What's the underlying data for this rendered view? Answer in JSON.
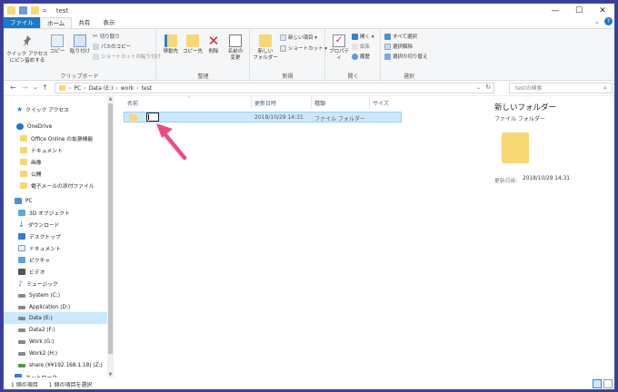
{
  "window": {
    "title": "test",
    "minimize": "—",
    "maximize": "☐",
    "close": "✕"
  },
  "tabs": [
    "ファイル",
    "ホーム",
    "共有",
    "表示"
  ],
  "ribbon": {
    "clipboard": {
      "pin_quick_line1": "クイック アクセス",
      "pin_quick_line2": "にピン留めする",
      "copy": "コピー",
      "paste": "貼り付け",
      "cut": "切り取り",
      "copy_path": "パスのコピー",
      "paste_shortcut": "ショートカットの貼り付け",
      "label": "クリップボード"
    },
    "organize": {
      "move_to": "移動先",
      "copy_to": "コピー先",
      "delete": "削除",
      "rename_line1": "名前の",
      "rename_line2": "変更",
      "label": "整理"
    },
    "new": {
      "new_folder_line1": "新しい",
      "new_folder_line2": "フォルダー",
      "new_item": "新しい項目 ▾",
      "shortcut": "ショートカット ▾",
      "label": "新規"
    },
    "open": {
      "properties": "プロパティ",
      "open": "開く ▾",
      "edit": "編集",
      "history": "履歴",
      "label": "開く"
    },
    "select": {
      "select_all": "すべて選択",
      "select_none": "選択解除",
      "invert": "選択の切り替え",
      "label": "選択"
    }
  },
  "address": {
    "back": "←",
    "forward": "→",
    "up_dropdown": "⌄",
    "up": "↑",
    "crumbs": [
      "PC",
      "Data (E:)",
      "work",
      "test"
    ],
    "sep": "›",
    "refresh": "↻",
    "search_placeholder": "testの検索"
  },
  "nav": {
    "quick": "クイック アクセス",
    "onedrive": "OneDrive",
    "onedrive_items": [
      "Office Online の拡張機能",
      "ドキュメント",
      "画像",
      "公開",
      "電子メールの添付ファイル"
    ],
    "pc": "PC",
    "pc_items": [
      "3D オブジェクト",
      "ダウンロード",
      "デスクトップ",
      "ドキュメント",
      "ピクチャ",
      "ビデオ",
      "ミュージック",
      "System (C:)",
      "Application (D:)",
      "Data (E:)",
      "Data2 (F:)",
      "Work (G:)",
      "Work2 (H:)",
      "share (¥¥192.168.1.18) (Z:)"
    ],
    "network": "ネットワーク"
  },
  "columns": {
    "name": "名前",
    "date": "更新日時",
    "type": "種類",
    "size": "サイズ"
  },
  "row": {
    "date": "2018/10/29 14:31",
    "type": "ファイル フォルダー"
  },
  "preview": {
    "title": "新しいフォルダー",
    "subtitle": "ファイル フォルダー",
    "date_label": "更新日時:",
    "date": "2018/10/29 14:31"
  },
  "status": {
    "count": "1 個の項目",
    "selected": "1 個の項目を選択"
  },
  "colors": {
    "accent": "#1979ca",
    "selection": "#cce8ff",
    "arrow": "#ef4a7f",
    "folder": "#f8d775"
  }
}
